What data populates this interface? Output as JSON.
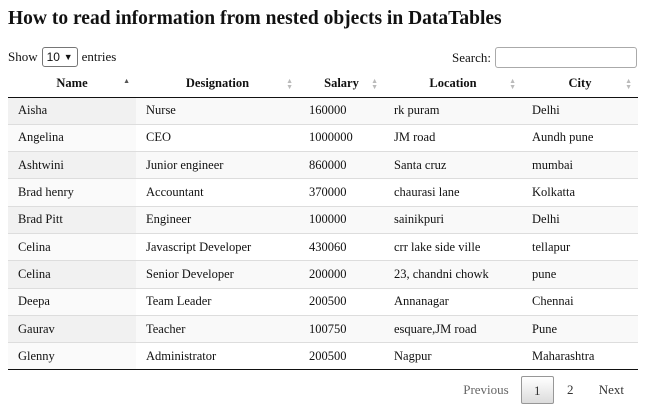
{
  "page": {
    "title": "How to read information from nested objects in DataTables"
  },
  "length_menu": {
    "prefix": "Show",
    "selected": "10",
    "suffix": "entries"
  },
  "search": {
    "label": "Search:",
    "value": ""
  },
  "table": {
    "columns": [
      "Name",
      "Designation",
      "Salary",
      "Location",
      "City"
    ],
    "sorted_column": "Name",
    "sort_direction": "ascending",
    "rows": [
      [
        "Aisha",
        "Nurse",
        "160000",
        "rk puram",
        "Delhi"
      ],
      [
        "Angelina",
        "CEO",
        "1000000",
        "JM road",
        "Aundh pune"
      ],
      [
        "Ashtwini",
        "Junior engineer",
        "860000",
        "Santa cruz",
        "mumbai"
      ],
      [
        "Brad henry",
        "Accountant",
        "370000",
        "chaurasi lane",
        "Kolkatta"
      ],
      [
        "Brad Pitt",
        "Engineer",
        "100000",
        "sainikpuri",
        "Delhi"
      ],
      [
        "Celina",
        "Javascript Developer",
        "430060",
        "crr lake side ville",
        "tellapur"
      ],
      [
        "Celina",
        "Senior Developer",
        "200000",
        "23, chandni chowk",
        "pune"
      ],
      [
        "Deepa",
        "Team Leader",
        "200500",
        "Annanagar",
        "Chennai"
      ],
      [
        "Gaurav",
        "Teacher",
        "100750",
        "esquare,JM road",
        "Pune"
      ],
      [
        "Glenny",
        "Administrator",
        "200500",
        "Nagpur",
        "Maharashtra"
      ]
    ]
  },
  "pagination": {
    "previous": "Previous",
    "pages": [
      "1",
      "2"
    ],
    "current": "1",
    "next": "Next"
  }
}
